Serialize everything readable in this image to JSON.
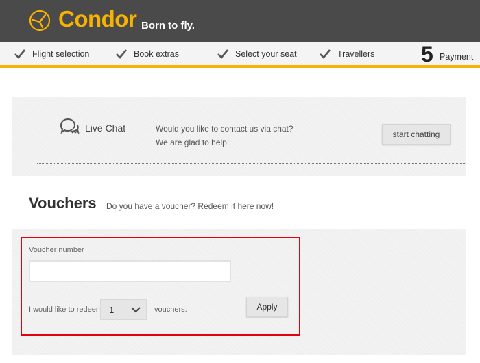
{
  "header": {
    "logo_text": "Condor",
    "tagline": "Born to fly."
  },
  "steps": {
    "items": [
      {
        "label": "Flight selection",
        "icon": "check-icon"
      },
      {
        "label": "Book extras",
        "icon": "check-icon"
      },
      {
        "label": "Select your seat",
        "icon": "check-icon"
      },
      {
        "label": "Travellers",
        "icon": "check-icon"
      }
    ],
    "current_number": "5",
    "current_label": "Payment"
  },
  "chat": {
    "title": "Live Chat",
    "line1": "Would you like to contact us via chat?",
    "line2": "We are glad to help!",
    "button_label": "start chatting",
    "icon": "chat-bubbles-icon"
  },
  "vouchers": {
    "title": "Vouchers",
    "subtitle": "Do you have a voucher? Redeem it here now!",
    "number_label": "Voucher number",
    "number_value": "",
    "redeem_prefix": "I would like to redeem",
    "count_selected": "1",
    "redeem_suffix": "vouchers.",
    "apply_label": "Apply"
  },
  "colors": {
    "brand_yellow": "#f8b200",
    "header_bg": "#4a4a4a",
    "highlight_red": "#e3000f"
  }
}
